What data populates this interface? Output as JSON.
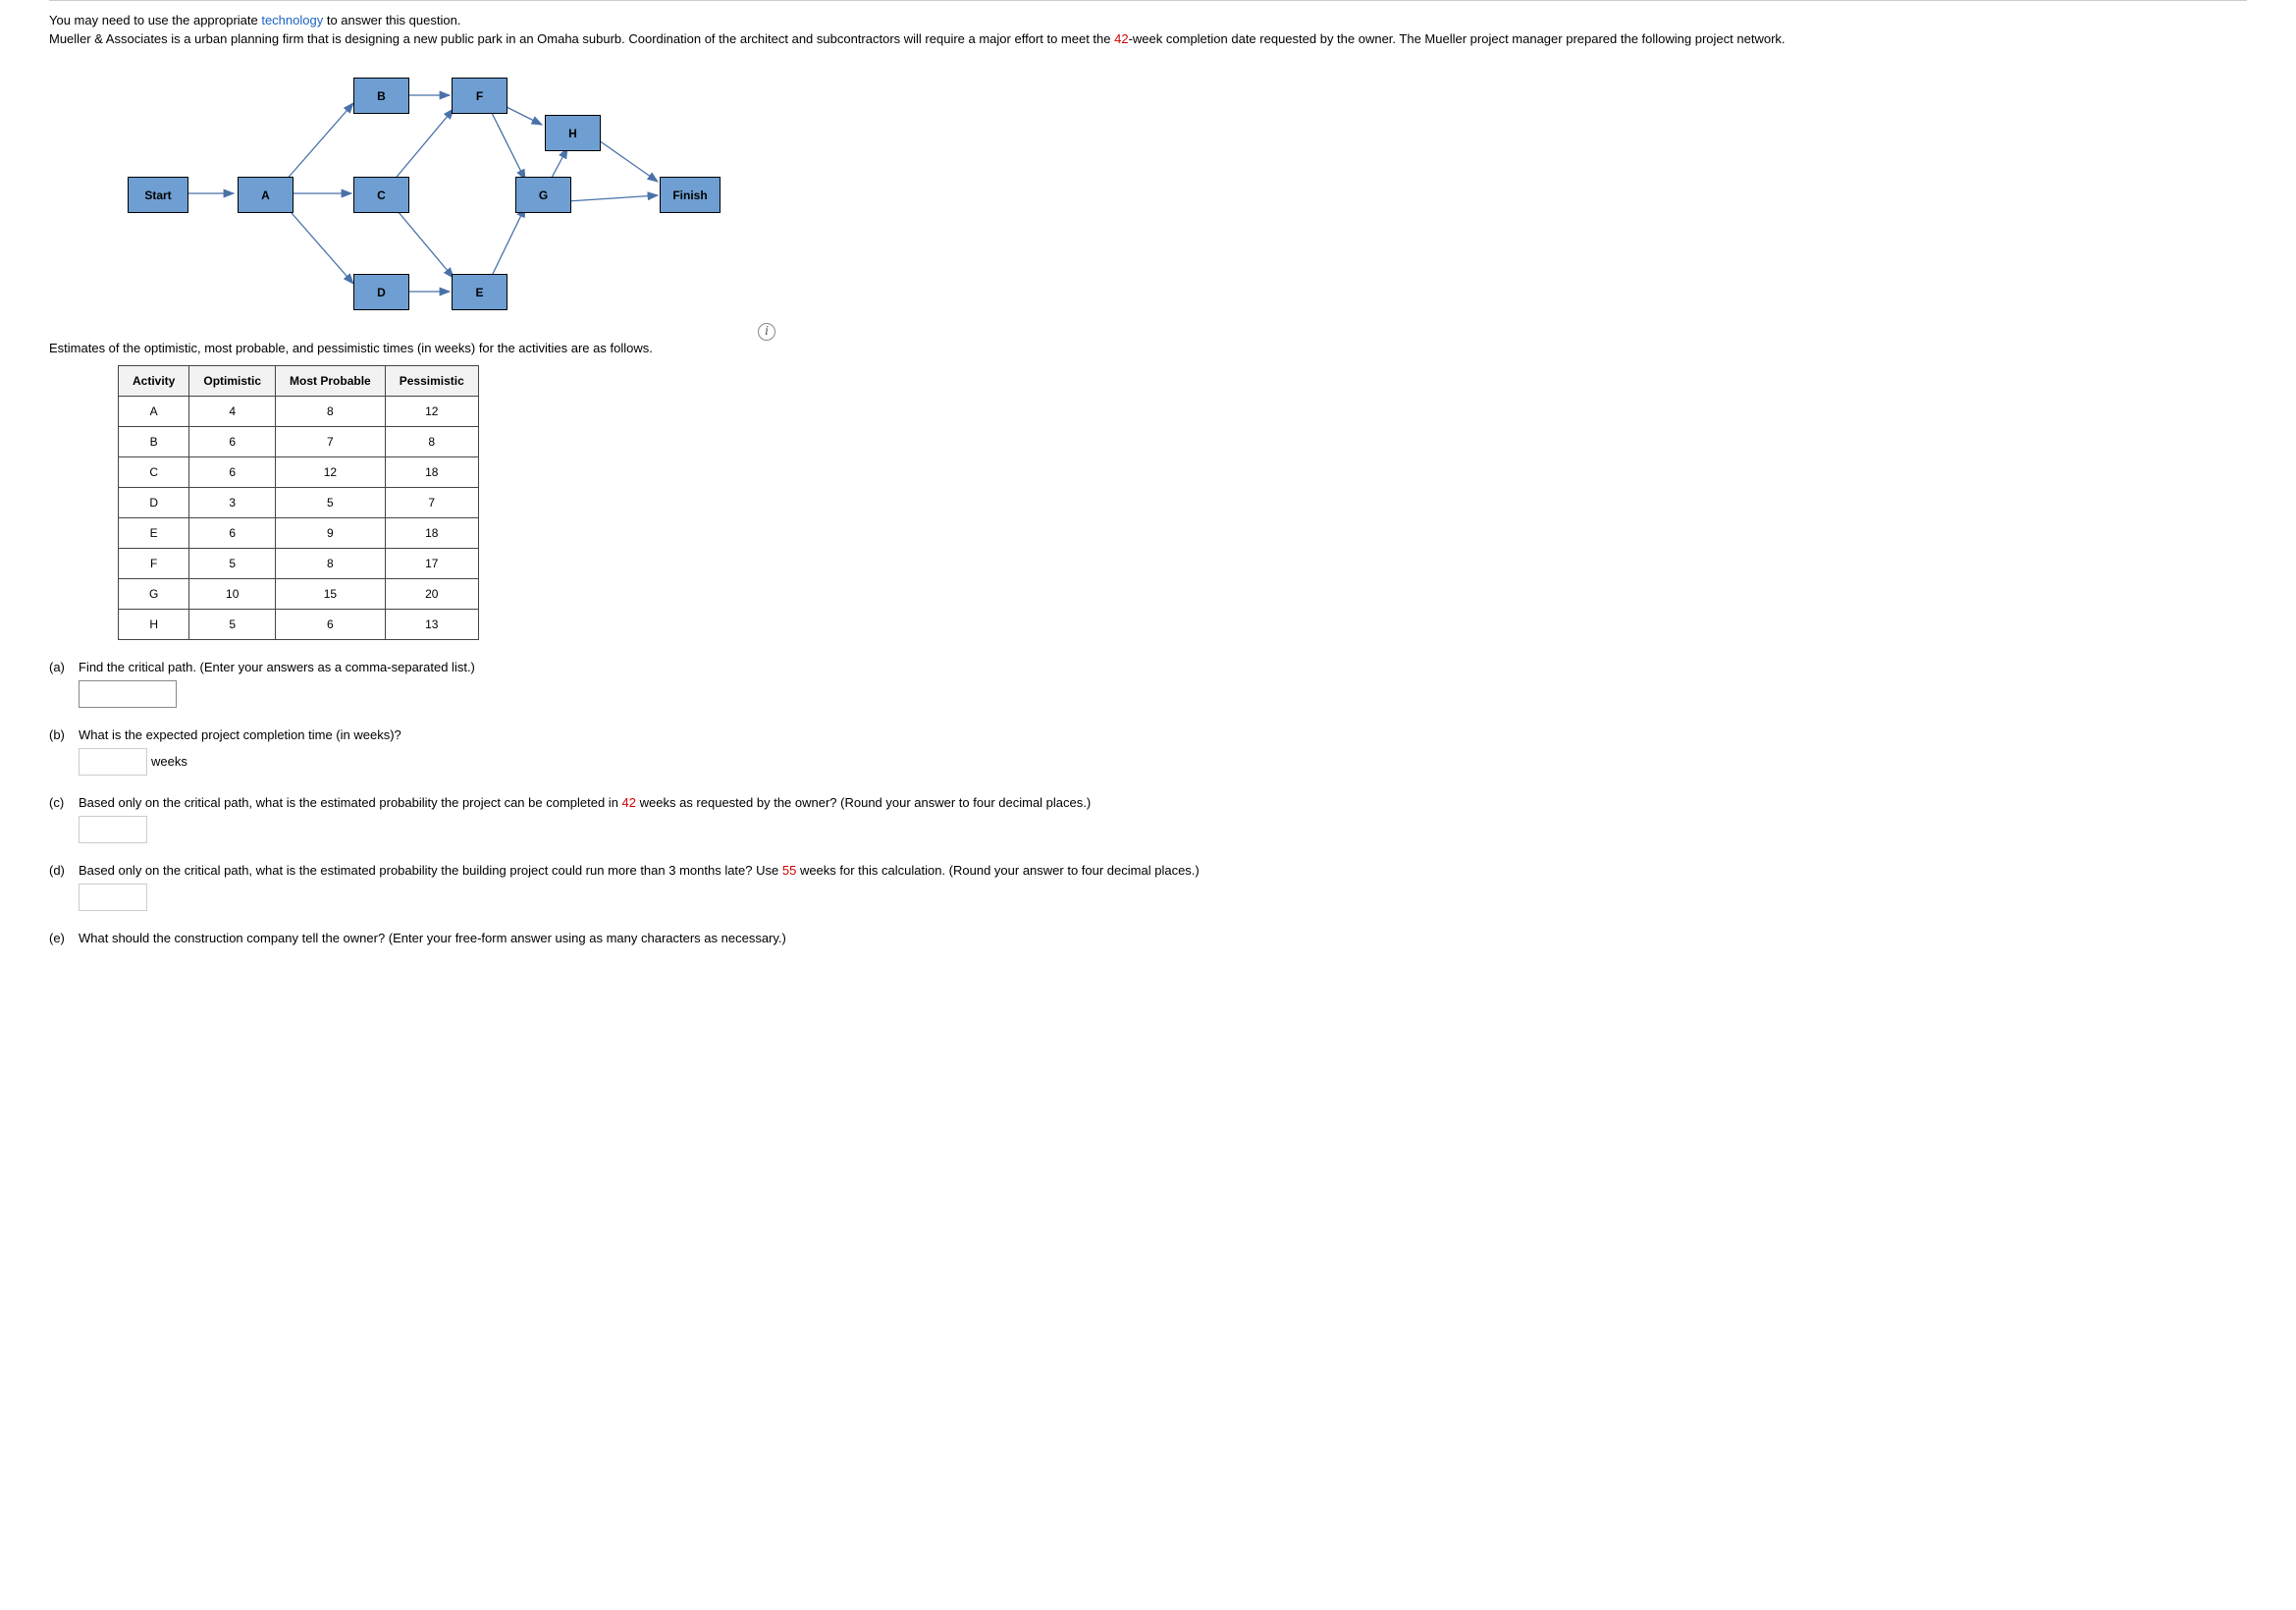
{
  "intro": {
    "line1_pre": "You may need to use the appropriate ",
    "line1_link": "technology",
    "line1_post": " to answer this question.",
    "line2_pre": "Mueller & Associates is a urban planning firm that is designing a new public park in an Omaha suburb. Coordination of the architect and subcontractors will require a major effort to meet the ",
    "line2_red": "42",
    "line2_post": "-week completion date requested by the owner. The Mueller project manager prepared the following project network."
  },
  "nodes": {
    "start": "Start",
    "A": "A",
    "B": "B",
    "C": "C",
    "D": "D",
    "E": "E",
    "F": "F",
    "G": "G",
    "H": "H",
    "finish": "Finish"
  },
  "estimates_text": "Estimates of the optimistic, most probable, and pessimistic times (in weeks) for the activities are as follows.",
  "table": {
    "headers": [
      "Activity",
      "Optimistic",
      "Most Probable",
      "Pessimistic"
    ],
    "rows": [
      [
        "A",
        "4",
        "8",
        "12"
      ],
      [
        "B",
        "6",
        "7",
        "8"
      ],
      [
        "C",
        "6",
        "12",
        "18"
      ],
      [
        "D",
        "3",
        "5",
        "7"
      ],
      [
        "E",
        "6",
        "9",
        "18"
      ],
      [
        "F",
        "5",
        "8",
        "17"
      ],
      [
        "G",
        "10",
        "15",
        "20"
      ],
      [
        "H",
        "5",
        "6",
        "13"
      ]
    ]
  },
  "questions": {
    "a": {
      "label": "(a)",
      "text": "Find the critical path. (Enter your answers as a comma-separated list.)"
    },
    "b": {
      "label": "(b)",
      "text": "What is the expected project completion time (in weeks)?",
      "unit": "weeks"
    },
    "c": {
      "label": "(c)",
      "text_pre": "Based only on the critical path, what is the estimated probability the project can be completed in ",
      "red": "42",
      "text_post": " weeks as requested by the owner? (Round your answer to four decimal places.)"
    },
    "d": {
      "label": "(d)",
      "text_pre": "Based only on the critical path, what is the estimated probability the building project could run more than 3 months late? Use ",
      "red": "55",
      "text_post": " weeks for this calculation. (Round your answer to four decimal places.)"
    },
    "e": {
      "label": "(e)",
      "text": "What should the construction company tell the owner? (Enter your free-form answer using as many characters as necessary.)"
    }
  }
}
